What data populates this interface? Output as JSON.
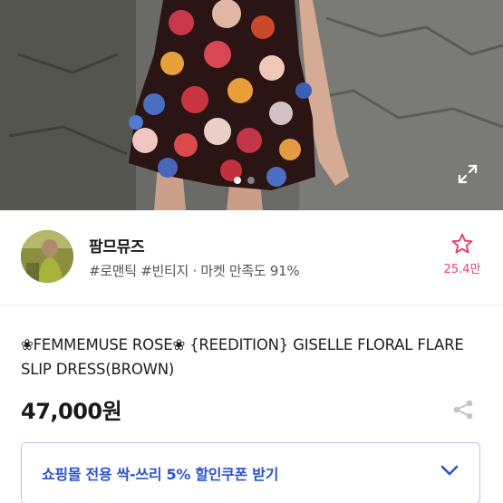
{
  "hero": {
    "image_alt": "model wearing floral mini slip dress",
    "carousel": {
      "total": 2,
      "active": 1
    },
    "expand_icon": "expand-icon"
  },
  "seller": {
    "name": "팜므뮤즈",
    "tags": "#로맨틱 #빈티지 · 마켓 만족도 91%",
    "favorite_icon": "star-outline-icon",
    "favorite_count": "25.4만",
    "accent_color": "#e7426b"
  },
  "product": {
    "title": "❀FEMMEMUSE ROSE❀ {REEDITION} GISELLE FLORAL FLARE SLIP DRESS(BROWN)",
    "price": "47,000원",
    "share_icon": "share-icon"
  },
  "coupon": {
    "label": "쇼핑몰 전용 싹-쓰리 5% 할인쿠폰 받기",
    "chevron_icon": "chevron-down-icon",
    "color": "#2b54c8"
  }
}
